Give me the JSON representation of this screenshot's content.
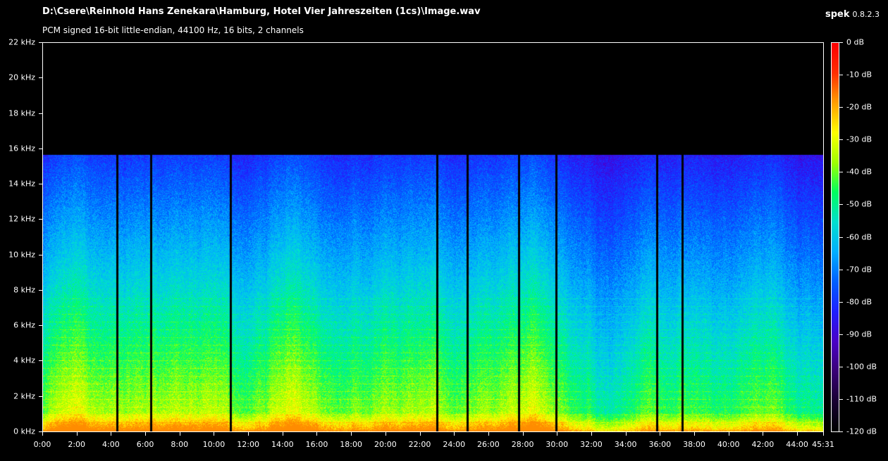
{
  "header": {
    "file_path": "D:\\Csere\\Reinhold Hans Zenekara\\Hamburg, Hotel Vier Jahreszeiten (1cs)\\Image.wav",
    "audio_info": "PCM signed 16-bit little-endian, 44100 Hz, 16 bits, 2 channels",
    "app_name": "spek",
    "app_version": "0.8.2.3"
  },
  "chart_data": {
    "type": "heatmap",
    "x_axis": {
      "unit": "mm:ss",
      "range_seconds": [
        0,
        2731
      ],
      "tick_labels": [
        "0:00",
        "2:00",
        "4:00",
        "6:00",
        "8:00",
        "10:00",
        "12:00",
        "14:00",
        "16:00",
        "18:00",
        "20:00",
        "22:00",
        "24:00",
        "26:00",
        "28:00",
        "30:00",
        "32:00",
        "34:00",
        "36:00",
        "38:00",
        "40:00",
        "42:00",
        "44:00",
        "45:31"
      ]
    },
    "y_axis": {
      "unit": "kHz",
      "range": [
        0,
        22
      ],
      "tick_labels": [
        "22 kHz",
        "20 kHz",
        "18 kHz",
        "16 kHz",
        "14 kHz",
        "12 kHz",
        "10 kHz",
        "8 kHz",
        "6 kHz",
        "4 kHz",
        "2 kHz",
        "0 kHz"
      ]
    },
    "color_scale": {
      "range_db": [
        -120,
        0
      ],
      "tick_labels": [
        "0 dB",
        "-10 dB",
        "-20 dB",
        "-30 dB",
        "-40 dB",
        "-50 dB",
        "-60 dB",
        "-70 dB",
        "-80 dB",
        "-90 dB",
        "-100 dB",
        "-110 dB",
        "-120 dB"
      ],
      "colors": [
        "#000000",
        "#1a0033",
        "#3a0077",
        "#4b00c8",
        "#2020ff",
        "#0060ff",
        "#00b0ff",
        "#00e0d0",
        "#00ff60",
        "#a0ff00",
        "#ffff00",
        "#ffa000",
        "#ff3000",
        "#ff0000"
      ]
    },
    "cutoff_khz": 15.7,
    "track_breaks_seconds": [
      260,
      377,
      657,
      1379,
      1485,
      1666,
      1796,
      2148,
      2238
    ]
  }
}
